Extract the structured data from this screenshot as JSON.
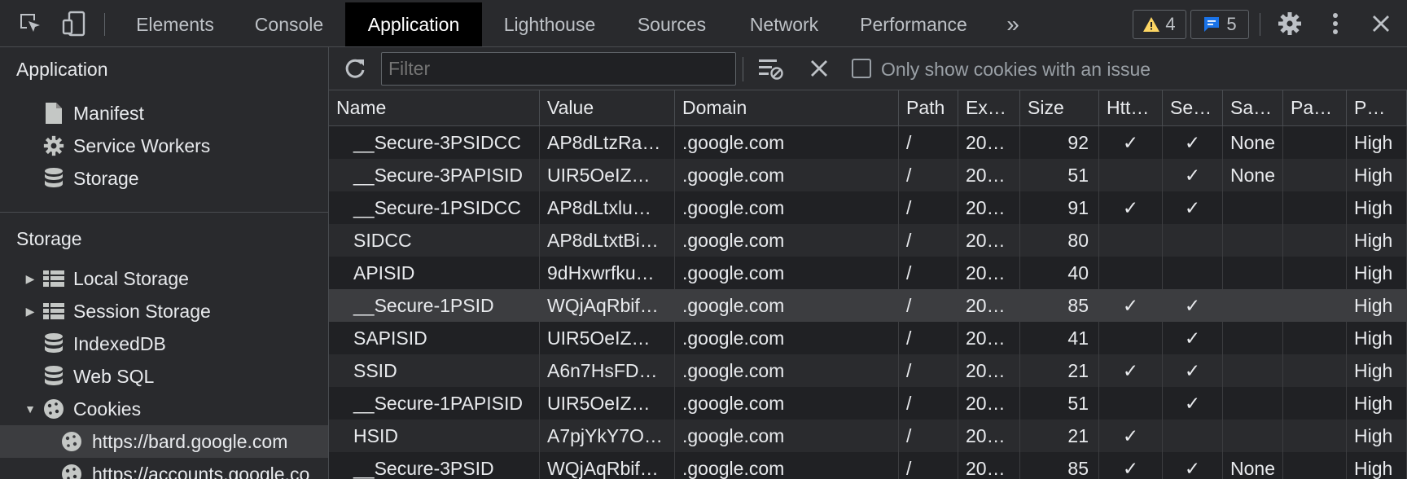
{
  "tabs": [
    {
      "label": "Elements"
    },
    {
      "label": "Console"
    },
    {
      "label": "Application"
    },
    {
      "label": "Lighthouse"
    },
    {
      "label": "Sources"
    },
    {
      "label": "Network"
    },
    {
      "label": "Performance"
    }
  ],
  "more_tabs_label": "»",
  "badges": {
    "warnings": "4",
    "messages": "5"
  },
  "sidebar": {
    "application_heading": "Application",
    "application_items": [
      {
        "label": "Manifest",
        "icon": "document-icon"
      },
      {
        "label": "Service Workers",
        "icon": "gear-icon"
      },
      {
        "label": "Storage",
        "icon": "database-icon"
      }
    ],
    "storage_heading": "Storage",
    "storage_items": [
      {
        "label": "Local Storage",
        "icon": "grid-icon",
        "expandable": true
      },
      {
        "label": "Session Storage",
        "icon": "grid-icon",
        "expandable": true
      },
      {
        "label": "IndexedDB",
        "icon": "database-icon"
      },
      {
        "label": "Web SQL",
        "icon": "database-icon"
      },
      {
        "label": "Cookies",
        "icon": "cookie-icon",
        "expanded": true
      }
    ],
    "cookie_sites": [
      {
        "label": "https://bard.google.com",
        "selected": true
      },
      {
        "label": "https://accounts.google.co"
      }
    ]
  },
  "toolbar": {
    "filter_placeholder": "Filter",
    "only_issues_label": "Only show cookies with an issue"
  },
  "table": {
    "columns": [
      "Name",
      "Value",
      "Domain",
      "Path",
      "Ex…",
      "Size",
      "Htt…",
      "Se…",
      "Sa…",
      "Pa…",
      "P…"
    ],
    "rows": [
      [
        "__Secure-3PSIDCC",
        "AP8dLtzRa…",
        ".google.com",
        "/",
        "20…",
        "92",
        "✓",
        "✓",
        "None",
        "",
        "High"
      ],
      [
        "__Secure-3PAPISID",
        "UIR5OeIZ…",
        ".google.com",
        "/",
        "20…",
        "51",
        "",
        "✓",
        "None",
        "",
        "High"
      ],
      [
        "__Secure-1PSIDCC",
        "AP8dLtxlu…",
        ".google.com",
        "/",
        "20…",
        "91",
        "✓",
        "✓",
        "",
        "",
        "High"
      ],
      [
        "SIDCC",
        "AP8dLtxtBi…",
        ".google.com",
        "/",
        "20…",
        "80",
        "",
        "",
        "",
        "",
        "High"
      ],
      [
        "APISID",
        "9dHxwrfku…",
        ".google.com",
        "/",
        "20…",
        "40",
        "",
        "",
        "",
        "",
        "High"
      ],
      [
        "__Secure-1PSID",
        "WQjAqRbif…",
        ".google.com",
        "/",
        "20…",
        "85",
        "✓",
        "✓",
        "",
        "",
        "High"
      ],
      [
        "SAPISID",
        "UIR5OeIZ…",
        ".google.com",
        "/",
        "20…",
        "41",
        "",
        "✓",
        "",
        "",
        "High"
      ],
      [
        "SSID",
        "A6n7HsFD…",
        ".google.com",
        "/",
        "20…",
        "21",
        "✓",
        "✓",
        "",
        "",
        "High"
      ],
      [
        "__Secure-1PAPISID",
        "UIR5OeIZ…",
        ".google.com",
        "/",
        "20…",
        "51",
        "",
        "✓",
        "",
        "",
        "High"
      ],
      [
        "HSID",
        "A7pjYkY7O…",
        ".google.com",
        "/",
        "20…",
        "21",
        "✓",
        "",
        "",
        "",
        "High"
      ],
      [
        "__Secure-3PSID",
        "WQjAqRbif…",
        ".google.com",
        "/",
        "20…",
        "85",
        "✓",
        "✓",
        "None",
        "",
        "High"
      ]
    ],
    "selected_row": 5
  },
  "colors": {
    "accent_blue": "#1a73e8",
    "warning_yellow": "#fdd663"
  }
}
